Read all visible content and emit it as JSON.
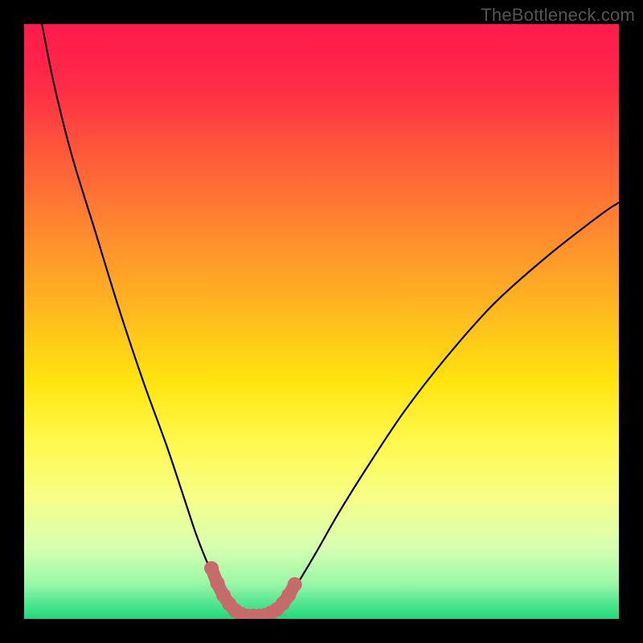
{
  "watermark": "TheBottleneck.com",
  "chart_data": {
    "type": "line",
    "title": "",
    "xlabel": "",
    "ylabel": "",
    "xlim": [
      0,
      100
    ],
    "ylim": [
      0,
      100
    ],
    "series": [
      {
        "name": "curve-left",
        "x": [
          3,
          5,
          8,
          12,
          16,
          20,
          24,
          27,
          29,
          31,
          33,
          34.5,
          36,
          37
        ],
        "values": [
          100,
          90,
          78,
          65,
          52,
          40,
          29,
          20,
          14,
          9,
          5,
          2.5,
          1,
          0.5
        ]
      },
      {
        "name": "curve-right",
        "x": [
          41,
          42.5,
          44,
          46,
          49,
          53,
          58,
          64,
          71,
          79,
          88,
          97,
          100
        ],
        "values": [
          0.5,
          1.5,
          3,
          6,
          11,
          18,
          26,
          35,
          44,
          53,
          61,
          68,
          70
        ]
      },
      {
        "name": "valley-marker",
        "x": [
          31.5,
          32.5,
          33.5,
          34.5,
          35.5,
          36.5,
          37.5,
          38.5,
          39.5,
          40.5,
          41.5,
          42.5,
          43.5,
          44.5,
          45.5
        ],
        "values": [
          8.5,
          6.0,
          4.0,
          2.5,
          1.4,
          0.8,
          0.5,
          0.5,
          0.5,
          0.6,
          1.0,
          1.6,
          2.6,
          4.0,
          5.8
        ]
      }
    ],
    "gradient_stops": [
      {
        "offset": 0.0,
        "color": "#ff1a4d"
      },
      {
        "offset": 0.1,
        "color": "#ff2a47"
      },
      {
        "offset": 0.22,
        "color": "#ff5a3a"
      },
      {
        "offset": 0.35,
        "color": "#ff8a2e"
      },
      {
        "offset": 0.48,
        "color": "#ffb81f"
      },
      {
        "offset": 0.6,
        "color": "#ffe40e"
      },
      {
        "offset": 0.7,
        "color": "#fff94a"
      },
      {
        "offset": 0.8,
        "color": "#f6ff8a"
      },
      {
        "offset": 0.88,
        "color": "#d7ffb0"
      },
      {
        "offset": 0.94,
        "color": "#9bf7a8"
      },
      {
        "offset": 0.975,
        "color": "#4fe58f"
      },
      {
        "offset": 1.0,
        "color": "#1fd97a"
      }
    ],
    "marker_color": "#c96a6a",
    "curve_color": "#000000"
  }
}
